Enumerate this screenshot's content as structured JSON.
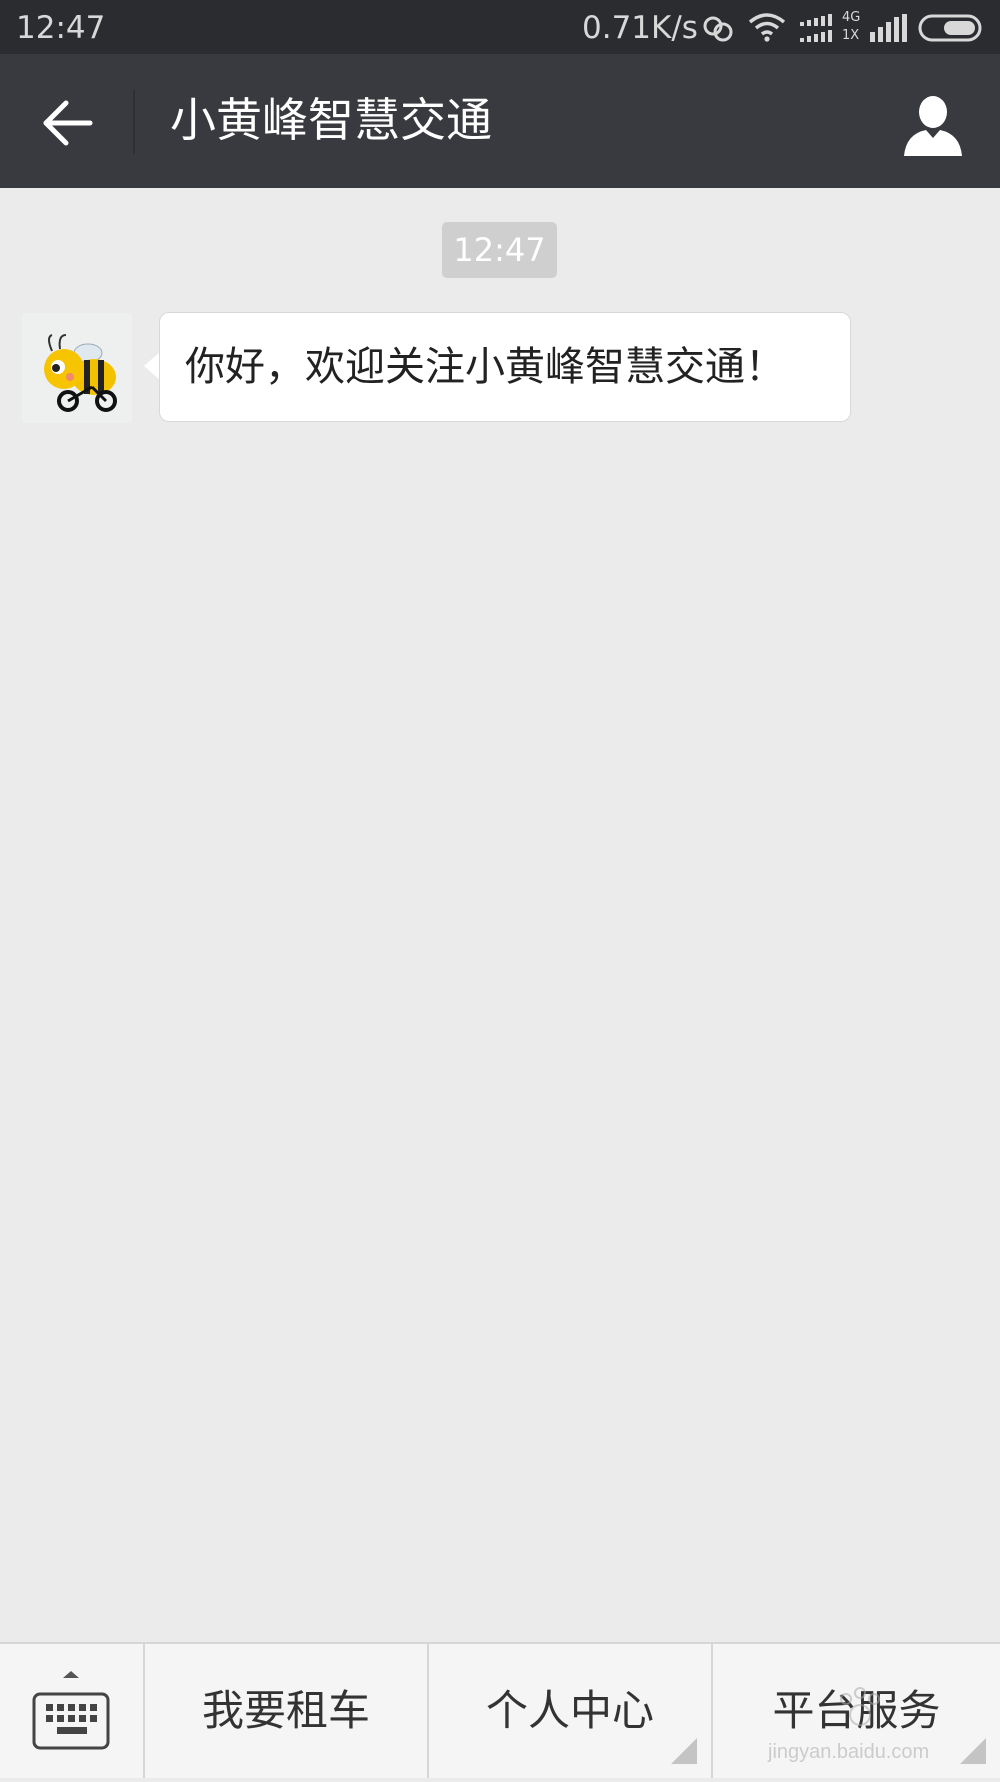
{
  "status_bar": {
    "time": "12:47",
    "network_speed": "0.71K/s",
    "network_label_top": "4G",
    "network_label_bottom": "1X",
    "icons": [
      "sync-icon",
      "wifi-icon",
      "signal-icon",
      "signal-icon",
      "battery-icon"
    ]
  },
  "header": {
    "title": "小黄峰智慧交通",
    "back_icon": "back-arrow-icon",
    "profile_icon": "person-icon"
  },
  "chat": {
    "timestamp": "12:47",
    "messages": [
      {
        "sender": "bot",
        "avatar_icon": "bee-avatar",
        "text": "你好，欢迎关注小黄峰智慧交通！"
      }
    ]
  },
  "bottom_menu": {
    "keyboard_icon": "keyboard-icon",
    "items": [
      {
        "label": "我要租车",
        "has_submenu": false
      },
      {
        "label": "个人中心",
        "has_submenu": true
      },
      {
        "label": "平台服务",
        "has_submenu": true
      }
    ]
  },
  "watermark": {
    "site": "jingyan.baidu.com"
  },
  "colors": {
    "status_bar_bg": "#2b2c30",
    "title_bar_bg": "#393a3f",
    "chat_bg": "#ebebeb",
    "bubble_bg": "#ffffff",
    "menu_bg": "#f5f5f5"
  }
}
